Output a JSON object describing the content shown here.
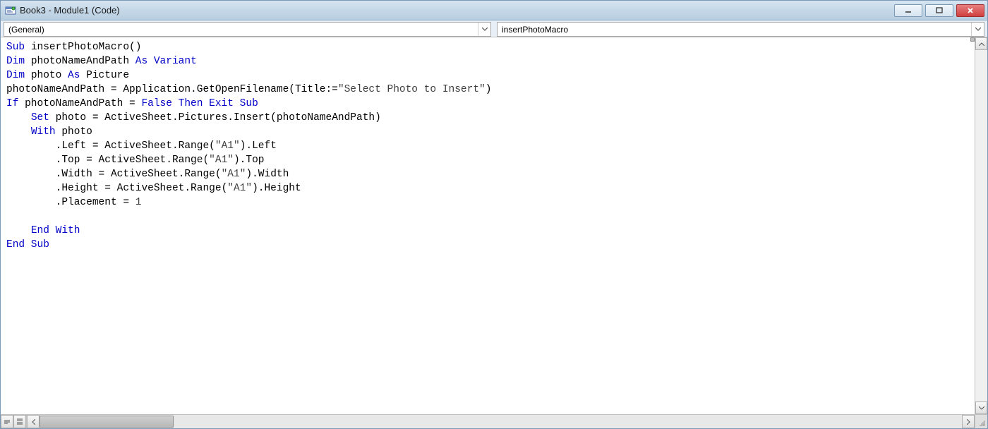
{
  "window": {
    "title": "Book3 - Module1 (Code)"
  },
  "dropdowns": {
    "object": "(General)",
    "procedure": "insertPhotoMacro"
  },
  "code": {
    "lines": [
      {
        "indent": 0,
        "tokens": [
          {
            "t": "Sub ",
            "c": "kw-blue"
          },
          {
            "t": "insertPhotoMacro()",
            "c": ""
          }
        ]
      },
      {
        "indent": 0,
        "tokens": [
          {
            "t": "Dim ",
            "c": "kw-blue"
          },
          {
            "t": "photoNameAndPath ",
            "c": ""
          },
          {
            "t": "As Variant",
            "c": "kw-blue"
          }
        ]
      },
      {
        "indent": 0,
        "tokens": [
          {
            "t": "Dim ",
            "c": "kw-blue"
          },
          {
            "t": "photo ",
            "c": ""
          },
          {
            "t": "As ",
            "c": "kw-blue"
          },
          {
            "t": "Picture",
            "c": ""
          }
        ]
      },
      {
        "indent": 0,
        "tokens": [
          {
            "t": "photoNameAndPath = Application.GetOpenFilename(Title:=",
            "c": ""
          },
          {
            "t": "\"Select Photo to Insert\"",
            "c": "str"
          },
          {
            "t": ")",
            "c": ""
          }
        ]
      },
      {
        "indent": 0,
        "tokens": [
          {
            "t": "If ",
            "c": "kw-blue"
          },
          {
            "t": "photoNameAndPath = ",
            "c": ""
          },
          {
            "t": "False Then Exit Sub",
            "c": "kw-blue"
          }
        ]
      },
      {
        "indent": 1,
        "tokens": [
          {
            "t": "Set ",
            "c": "kw-blue"
          },
          {
            "t": "photo = ActiveSheet.Pictures.Insert(photoNameAndPath)",
            "c": ""
          }
        ]
      },
      {
        "indent": 1,
        "tokens": [
          {
            "t": "With ",
            "c": "kw-blue"
          },
          {
            "t": "photo",
            "c": ""
          }
        ]
      },
      {
        "indent": 2,
        "tokens": [
          {
            "t": ".Left = ActiveSheet.Range(",
            "c": ""
          },
          {
            "t": "\"A1\"",
            "c": "str"
          },
          {
            "t": ").Left",
            "c": ""
          }
        ]
      },
      {
        "indent": 2,
        "tokens": [
          {
            "t": ".Top = ActiveSheet.Range(",
            "c": ""
          },
          {
            "t": "\"A1\"",
            "c": "str"
          },
          {
            "t": ").Top",
            "c": ""
          }
        ]
      },
      {
        "indent": 2,
        "tokens": [
          {
            "t": ".Width = ActiveSheet.Range(",
            "c": ""
          },
          {
            "t": "\"A1\"",
            "c": "str"
          },
          {
            "t": ").Width",
            "c": ""
          }
        ]
      },
      {
        "indent": 2,
        "tokens": [
          {
            "t": ".Height = ActiveSheet.Range(",
            "c": ""
          },
          {
            "t": "\"A1\"",
            "c": "str"
          },
          {
            "t": ").Height",
            "c": ""
          }
        ]
      },
      {
        "indent": 2,
        "tokens": [
          {
            "t": ".Placement = ",
            "c": ""
          },
          {
            "t": "1",
            "c": "num"
          }
        ]
      },
      {
        "indent": 0,
        "tokens": [
          {
            "t": "",
            "c": ""
          }
        ]
      },
      {
        "indent": 1,
        "tokens": [
          {
            "t": "End With",
            "c": "kw-blue"
          }
        ]
      },
      {
        "indent": 0,
        "tokens": [
          {
            "t": "End Sub",
            "c": "kw-blue"
          }
        ]
      }
    ],
    "indent_unit": "    "
  }
}
